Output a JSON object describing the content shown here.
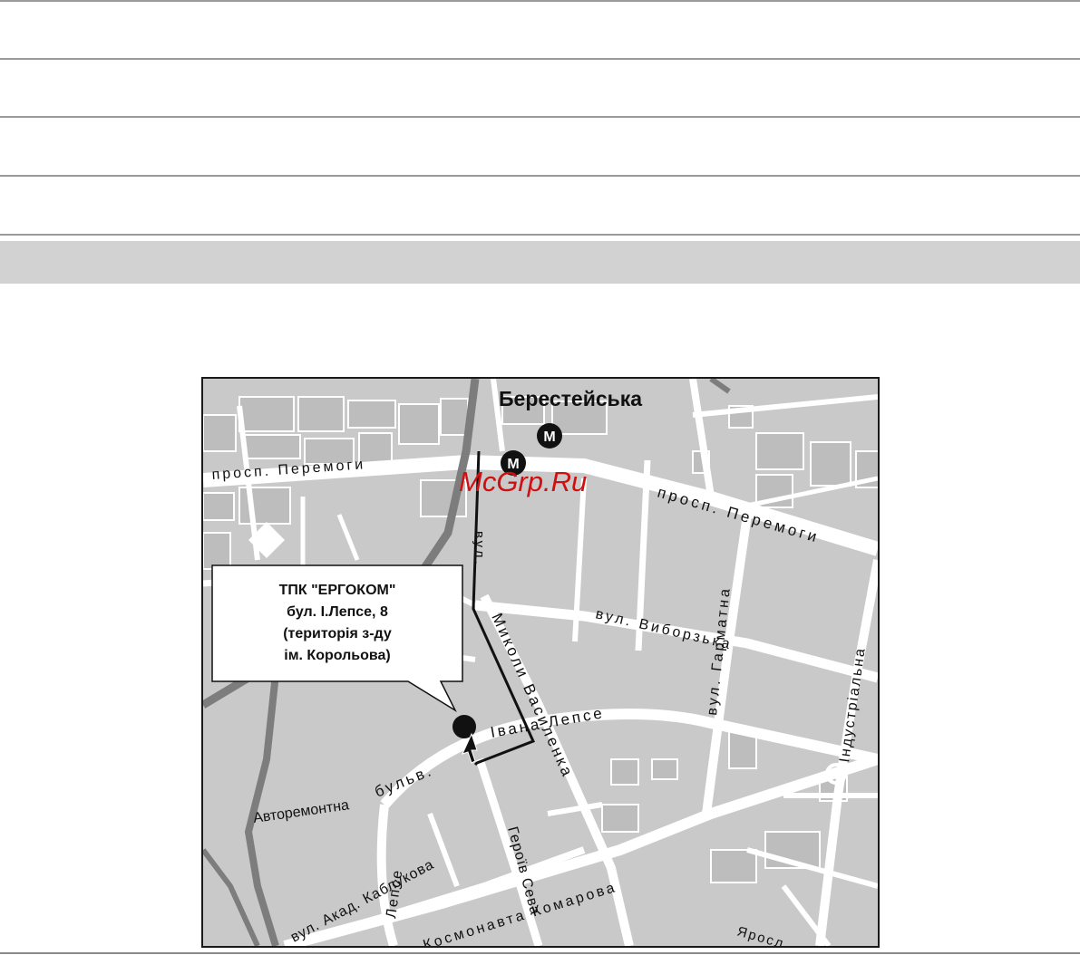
{
  "map": {
    "station": "Берестейська",
    "metro_marker": "M",
    "watermark": "McGrp.Ru",
    "callout": {
      "line1": "ТПК \"ЕРГОКОМ\"",
      "line2": "бул. І.Лепсе, 8",
      "line3": "(територія з-ду",
      "line4": "ім. Корольова)"
    },
    "streets": {
      "peremogy_west": "просп. Перемоги",
      "peremogy_east": "просп. Перемоги",
      "vasylenka_a": "вул.",
      "vasylenka_b": "Миколи Василенка",
      "vyborzka": "вул. Виборзька",
      "garmatna": "вул. Гарматна",
      "industrialna": "Індустріальна",
      "lepse_a": "бульв.",
      "lepse_b": "Івана Лепсе",
      "avtoremontna": "Авторемонтна",
      "lepse_vertical": "Лепсе",
      "kablukova": "вул. Акад. Каблукова",
      "geroiv": "Героїв Сева",
      "komarova": "а Космонавта Комарова",
      "yaroslav": "Яросл"
    },
    "colors": {
      "block": "#c9c9c9",
      "road": "#ffffff",
      "rail": "#7a7a7a",
      "watermark": "#d01010"
    }
  }
}
